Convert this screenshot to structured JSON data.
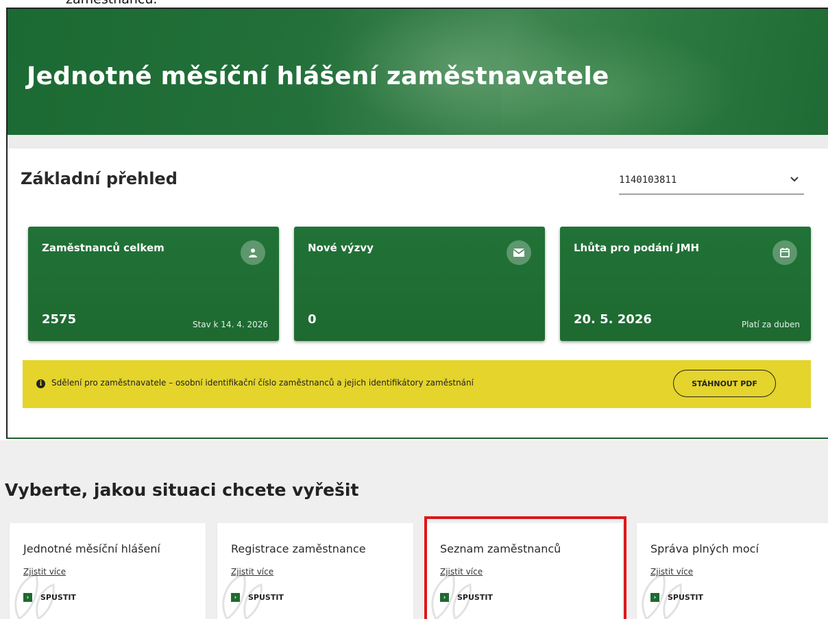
{
  "page": {
    "caption_fragment": "zaměstnanců."
  },
  "hero": {
    "title": "Jednotné měsíční hlášení zaměstnavatele"
  },
  "overview": {
    "title": "Základní přehled",
    "employer_id": "1140103811"
  },
  "cards": [
    {
      "title": "Zaměstnanců celkem",
      "value": "2575",
      "note": "Stav k 14. 4. 2026",
      "icon": "user-icon"
    },
    {
      "title": "Nové výzvy",
      "value": "0",
      "note": "",
      "icon": "envelope-icon"
    },
    {
      "title": "Lhůta pro podání JMH",
      "value": "20. 5. 2026",
      "note": "Platí za duben",
      "icon": "calendar-icon"
    }
  ],
  "notice": {
    "text": "Sdělení pro zaměstnavatele – osobní identifikační číslo zaměstnanců a jejich identifikátory zaměstnání",
    "button_label": "STÁHNOUT PDF",
    "icon": "info-icon"
  },
  "situations": {
    "title": "Vyberte, jakou situaci chcete vyřešit",
    "tiles": [
      {
        "title": "Jednotné měsíční hlášení",
        "link": "Zjistit více",
        "run_label": "SPUSTIT"
      },
      {
        "title": "Registrace zaměstnance",
        "link": "Zjistit více",
        "run_label": "SPUSTIT"
      },
      {
        "title": "Seznam zaměstnanců",
        "link": "Zjistit více",
        "run_label": "SPUSTIT"
      },
      {
        "title": "Správa plných mocí",
        "link": "Zjistit více",
        "run_label": "SPUSTIT"
      }
    ]
  },
  "colors": {
    "brand_green": "#1e6a31",
    "notice_yellow": "#e4d42c",
    "highlight_red": "#e0161a"
  }
}
